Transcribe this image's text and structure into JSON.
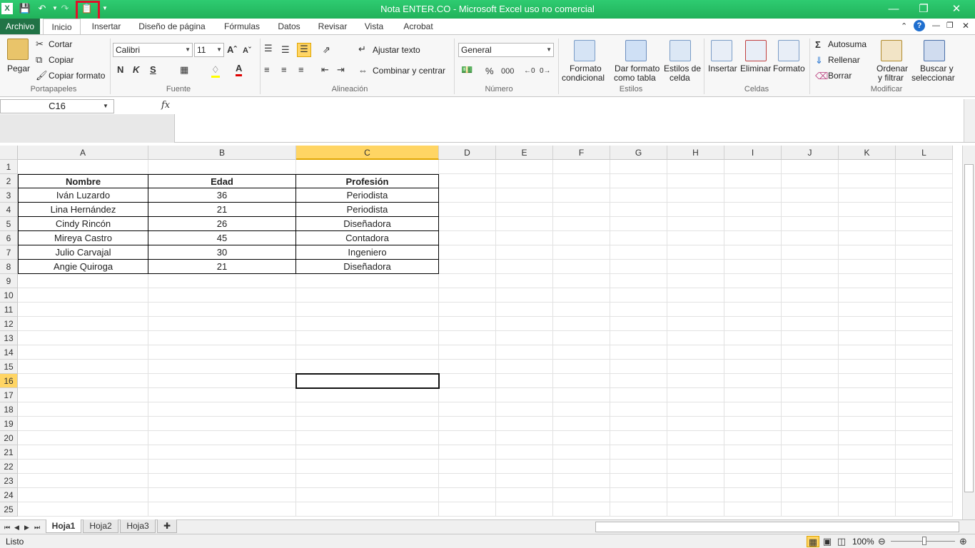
{
  "window": {
    "title": "Nota ENTER.CO  -  Microsoft Excel uso no comercial",
    "minimize": "—",
    "restore": "❐",
    "close": "✕"
  },
  "tabs": [
    "Archivo",
    "Inicio",
    "Insertar",
    "Diseño de página",
    "Fórmulas",
    "Datos",
    "Revisar",
    "Vista",
    "Acrobat"
  ],
  "ribbon": {
    "clipboard": {
      "pegar": "Pegar",
      "cortar": "Cortar",
      "copiar": "Copiar",
      "copiar_formato": "Copiar formato",
      "label": "Portapapeles"
    },
    "font": {
      "name": "Calibri",
      "size": "11",
      "bold": "N",
      "italic": "K",
      "underline": "S",
      "label": "Fuente"
    },
    "alignment": {
      "wrap": "Ajustar texto",
      "merge": "Combinar y centrar",
      "label": "Alineación"
    },
    "number": {
      "format": "General",
      "percent": "%",
      "thousands": "000",
      "label": "Número"
    },
    "styles": {
      "cond_l1": "Formato",
      "cond_l2": "condicional",
      "table_l1": "Dar formato",
      "table_l2": "como tabla",
      "cell_l1": "Estilos de",
      "cell_l2": "celda",
      "label": "Estilos"
    },
    "cells": {
      "insert": "Insertar",
      "delete": "Eliminar",
      "format": "Formato",
      "label": "Celdas"
    },
    "editing": {
      "autosum": "Autosuma",
      "fill": "Rellenar",
      "clear": "Borrar",
      "sort_l1": "Ordenar",
      "sort_l2": "y filtrar",
      "find_l1": "Buscar y",
      "find_l2": "seleccionar",
      "label": "Modificar"
    }
  },
  "formula_bar": {
    "name_box": "C16",
    "fx": "fx",
    "content": ""
  },
  "columns": [
    "A",
    "B",
    "C",
    "D",
    "E",
    "F",
    "G",
    "H",
    "I",
    "J",
    "K",
    "L"
  ],
  "rows": [
    "1",
    "2",
    "3",
    "4",
    "5",
    "6",
    "7",
    "8",
    "9",
    "10",
    "11",
    "12",
    "13",
    "14",
    "15",
    "16",
    "17",
    "18",
    "19",
    "20",
    "21",
    "22",
    "23",
    "24",
    "25"
  ],
  "table": {
    "headers": [
      "Nombre",
      "Edad",
      "Profesión"
    ],
    "rows": [
      [
        "Iván Luzardo",
        "36",
        "Periodista"
      ],
      [
        "Lina Hernández",
        "21",
        "Periodista"
      ],
      [
        "Cindy Rincón",
        "26",
        "Diseñadora"
      ],
      [
        "Mireya Castro",
        "45",
        "Contadora"
      ],
      [
        "Julio Carvajal",
        "30",
        "Ingeniero"
      ],
      [
        "Angie Quiroga",
        "21",
        "Diseñadora"
      ]
    ]
  },
  "active_cell": "C16",
  "sheets": [
    "Hoja1",
    "Hoja2",
    "Hoja3"
  ],
  "status": {
    "ready": "Listo",
    "zoom": "100%"
  }
}
